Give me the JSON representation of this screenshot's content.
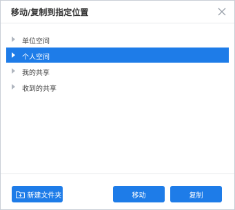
{
  "dialog": {
    "title": "移动/复制到指定位置"
  },
  "tree": {
    "items": [
      {
        "label": "单位空间",
        "selected": false
      },
      {
        "label": "个人空间",
        "selected": true
      },
      {
        "label": "我的共享",
        "selected": false
      },
      {
        "label": "收到的共享",
        "selected": false
      }
    ]
  },
  "footer": {
    "new_folder_label": "新建文件夹",
    "move_label": "移动",
    "copy_label": "复制"
  },
  "colors": {
    "accent": "#1e7ce8",
    "border": "#c9ced6",
    "text": "#333333"
  },
  "icons": {
    "close": "close-icon",
    "expand": "chevron-right-icon",
    "new_folder": "folder-plus-icon"
  }
}
